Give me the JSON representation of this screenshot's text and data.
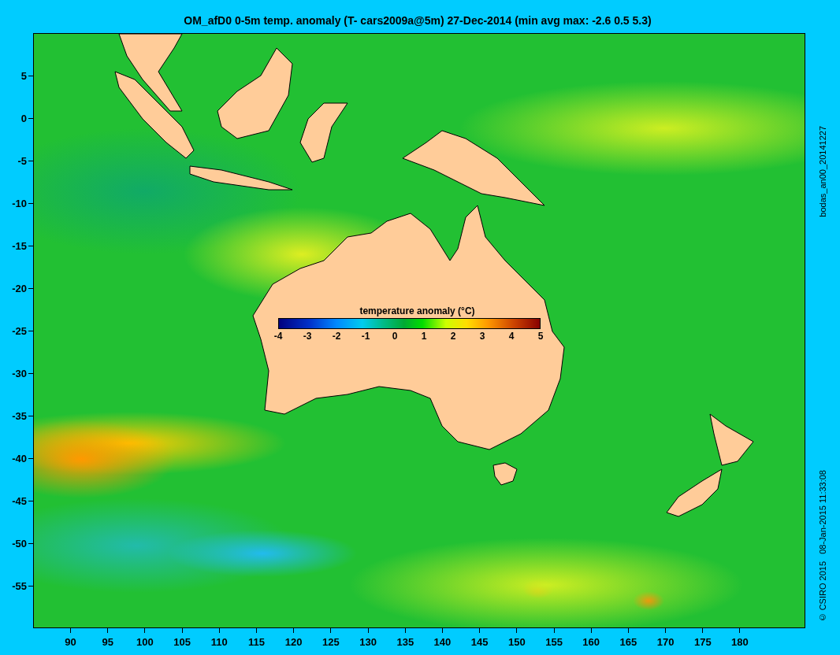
{
  "title": "OM_afD0 0-5m temp. anomaly (T- cars2009a@5m) 27-Dec-2014 (min avg max: -2.6 0.5 5.3)",
  "map": {
    "y_axis_labels": [
      "5",
      "0",
      "-5",
      "-10",
      "-15",
      "-20",
      "-25",
      "-30",
      "-35",
      "-40",
      "-45",
      "-50",
      "-55"
    ],
    "x_axis_labels": [
      "90",
      "95",
      "100",
      "105",
      "110",
      "115",
      "120",
      "125",
      "130",
      "135",
      "140",
      "145",
      "150",
      "155",
      "160",
      "165",
      "170",
      "175",
      "180"
    ],
    "legend": {
      "title": "temperature anomaly (°C)",
      "ticks": [
        "-4",
        "-3",
        "-2",
        "-1",
        "0",
        "1",
        "2",
        "3",
        "4",
        "5"
      ]
    }
  },
  "side_labels": [
    "bodas_an00_20141227",
    "© CSIRO 2015   08-Jan-2015 11:33:08"
  ]
}
